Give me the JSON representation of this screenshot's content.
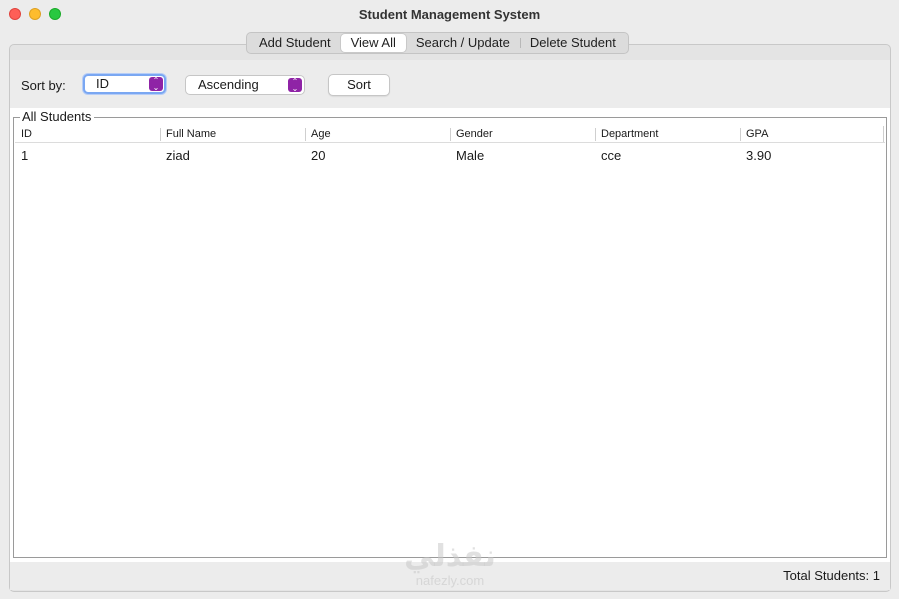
{
  "window": {
    "title": "Student Management System"
  },
  "tabs": [
    {
      "label": "Add Student"
    },
    {
      "label": "View All"
    },
    {
      "label": "Search / Update"
    },
    {
      "label": "Delete Student"
    }
  ],
  "toolbar": {
    "sort_label": "Sort by:",
    "sort_field_value": "ID",
    "sort_order_value": "Ascending",
    "sort_button_label": "Sort"
  },
  "list": {
    "group_title": "All Students",
    "columns": [
      "ID",
      "Full Name",
      "Age",
      "Gender",
      "Department",
      "GPA"
    ],
    "rows": [
      [
        "1",
        "ziad",
        "20",
        "Male",
        "cce",
        "3.90"
      ]
    ]
  },
  "status": {
    "total_text": "Total Students: 1"
  },
  "watermark": {
    "logo_text": "نفذلي",
    "url_text": "nafezly.com"
  },
  "colors": {
    "accent_combo": "#8f23a6",
    "focus_ring": "#7aa7f2",
    "close": "#fe5f57",
    "minimize": "#febc2e",
    "maximize": "#28c840"
  }
}
